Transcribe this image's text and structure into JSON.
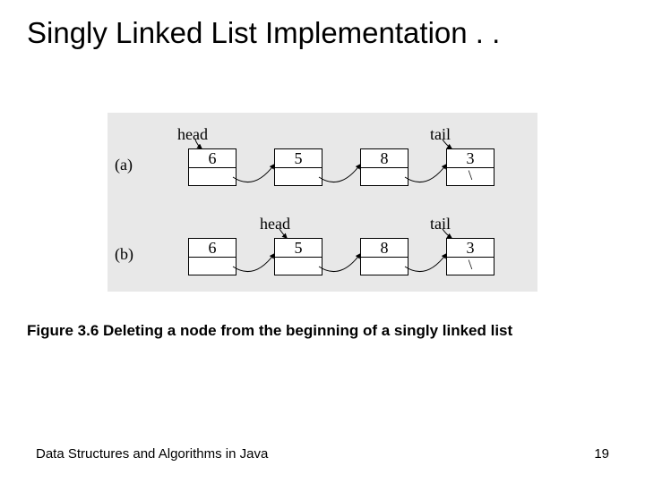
{
  "title": "Singly Linked List Implementation . .",
  "caption": "Figure 3.6 Deleting a node from the beginning of a singly linked list",
  "footer": {
    "left": "Data Structures and Algorithms in Java",
    "page": "19"
  },
  "figure": {
    "rows": [
      {
        "label": "(a)",
        "head_label": "head",
        "tail_label": "tail",
        "nodes": [
          {
            "value": "6",
            "null": false
          },
          {
            "value": "5",
            "null": false
          },
          {
            "value": "8",
            "null": false
          },
          {
            "value": "3",
            "null": true
          }
        ],
        "head_points_to": 0
      },
      {
        "label": "(b)",
        "head_label": "head",
        "tail_label": "tail",
        "nodes": [
          {
            "value": "6",
            "null": false
          },
          {
            "value": "5",
            "null": false
          },
          {
            "value": "8",
            "null": false
          },
          {
            "value": "3",
            "null": true
          }
        ],
        "head_points_to": 1
      }
    ],
    "null_glyph": "\\"
  }
}
